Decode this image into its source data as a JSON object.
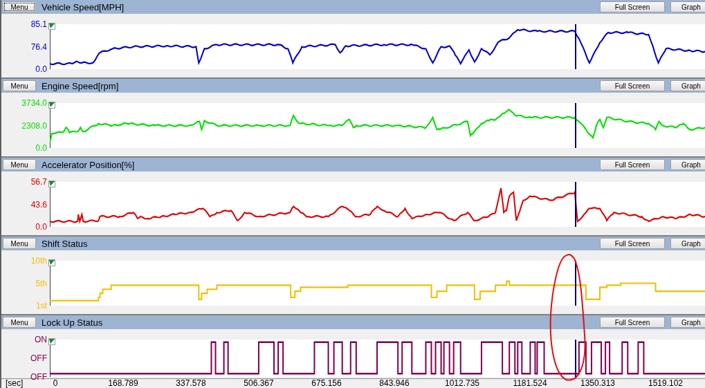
{
  "panels": [
    {
      "title": "Vehicle Speed[MPH]",
      "kind": "speed",
      "color": "#0000c8",
      "menu": {
        "label": "Menu",
        "focused": true
      },
      "buttons": [
        "Full Screen",
        "Graph"
      ],
      "y_labels": [
        "85.1",
        "76.4",
        "0.0"
      ]
    },
    {
      "title": "Engine Speed[rpm]",
      "kind": "rpm",
      "color": "#00e000",
      "menu": {
        "label": "Menu",
        "focused": false
      },
      "buttons": [
        "Full Screen",
        "Graph"
      ],
      "y_labels": [
        "3734.0",
        "2308.0",
        "0.0"
      ]
    },
    {
      "title": "Accelerator Position[%]",
      "kind": "pedal",
      "color": "#e00000",
      "menu": {
        "label": "Menu",
        "focused": false
      },
      "buttons": [
        "Full Screen",
        "Graph"
      ],
      "y_labels": [
        "56.7",
        "43.6",
        "0.0"
      ]
    },
    {
      "title": "Shift Status",
      "kind": "gear",
      "color": "#f0c000",
      "menu": {
        "label": "Menu",
        "focused": false
      },
      "buttons": [
        "Full Screen",
        "Graph"
      ],
      "y_labels": [
        "10th",
        "5th",
        "1st"
      ]
    },
    {
      "title": "Lock Up Status",
      "kind": "lockup",
      "color": "#800050",
      "menu": {
        "label": "Menu",
        "focused": false
      },
      "buttons": [
        "Full Screen",
        "Graph"
      ],
      "y_labels": [
        "ON",
        "OFF",
        "OFF"
      ]
    }
  ],
  "cursor": {
    "visible": true
  },
  "annotation": {
    "kind": "freehand-loop"
  },
  "time_axis": {
    "unit": "[sec]",
    "ticks": [
      "0",
      "168.789",
      "337.578",
      "506.367",
      "675.156",
      "843.946",
      "1012.735",
      "1181.524",
      "1350.313",
      "1519.102"
    ]
  }
}
